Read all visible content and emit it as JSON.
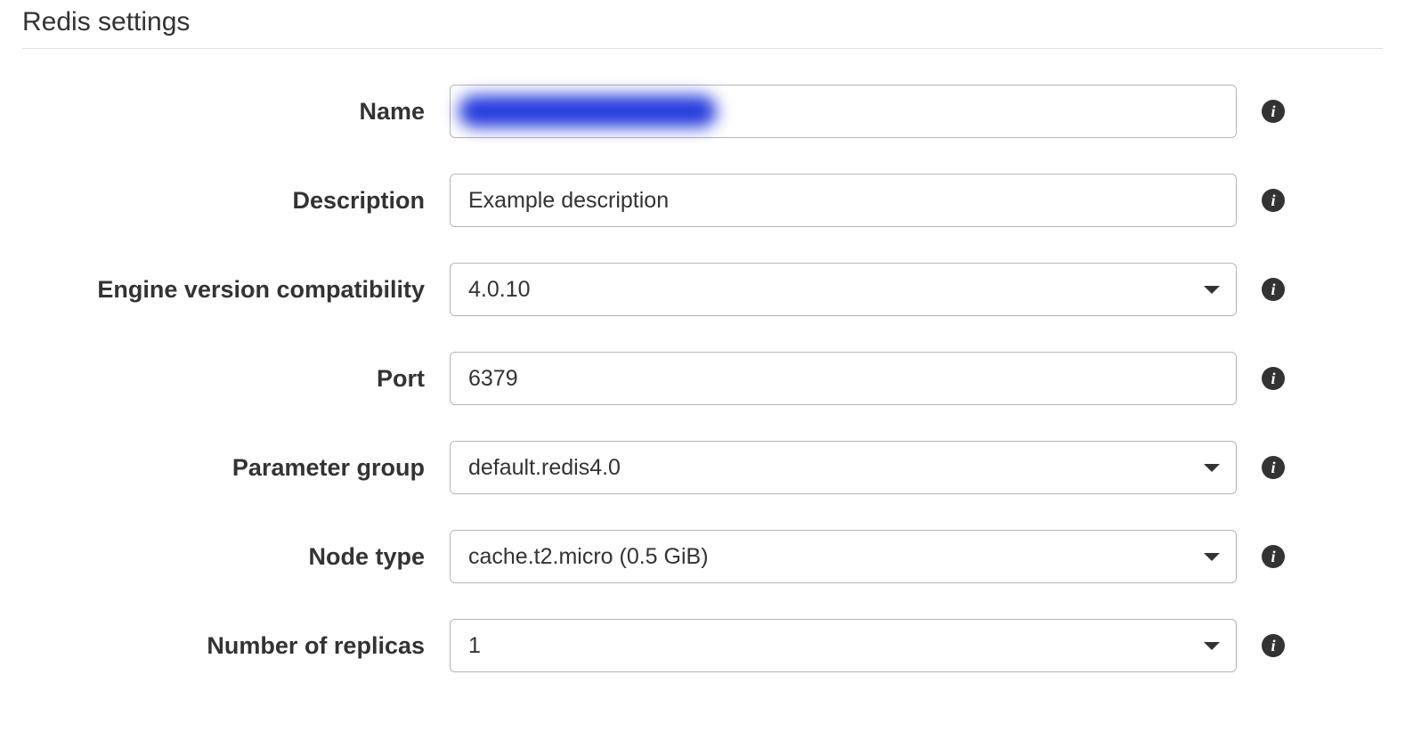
{
  "section_title": "Redis settings",
  "fields": {
    "name": {
      "label": "Name",
      "value": ""
    },
    "description": {
      "label": "Description",
      "value": "Example description"
    },
    "engine_version": {
      "label": "Engine version compatibility",
      "value": "4.0.10"
    },
    "port": {
      "label": "Port",
      "value": "6379"
    },
    "parameter_group": {
      "label": "Parameter group",
      "value": "default.redis4.0"
    },
    "node_type": {
      "label": "Node type",
      "value": "cache.t2.micro (0.5 GiB)"
    },
    "replicas": {
      "label": "Number of replicas",
      "value": "1"
    }
  },
  "info_glyph": "i"
}
